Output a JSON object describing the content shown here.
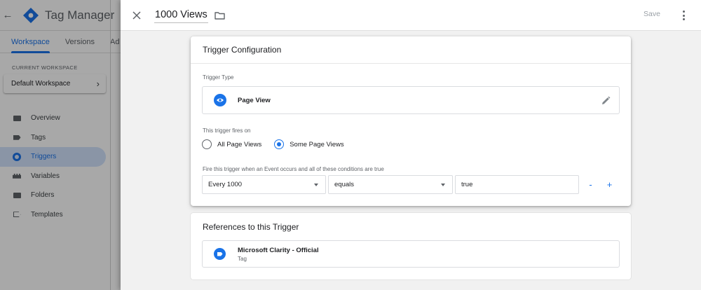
{
  "bg_app": {
    "product_name": "Tag Manager",
    "tabs": [
      {
        "label": "Workspace",
        "active": true
      },
      {
        "label": "Versions",
        "active": false
      },
      {
        "label": "Ad",
        "active": false
      }
    ],
    "current_workspace_label": "CURRENT WORKSPACE",
    "workspace_name": "Default Workspace",
    "nav": [
      {
        "label": "Overview",
        "icon": "folder-icon",
        "active": false
      },
      {
        "label": "Tags",
        "icon": "tag-icon",
        "active": false
      },
      {
        "label": "Triggers",
        "icon": "trigger-icon",
        "active": true
      },
      {
        "label": "Variables",
        "icon": "variables-icon",
        "active": false
      },
      {
        "label": "Folders",
        "icon": "folder-icon",
        "active": false
      },
      {
        "label": "Templates",
        "icon": "template-icon",
        "active": false
      }
    ]
  },
  "panel": {
    "title": "1000 Views",
    "save_label": "Save"
  },
  "trigger_config": {
    "heading": "Trigger Configuration",
    "type_label": "Trigger Type",
    "type_name": "Page View",
    "fires_on_label": "This trigger fires on",
    "fires_on_options": [
      {
        "label": "All Page Views",
        "checked": false
      },
      {
        "label": "Some Page Views",
        "checked": true
      }
    ],
    "condition_label": "Fire this trigger when an Event occurs and all of these conditions are true",
    "condition": {
      "variable": "Every 1000",
      "operator": "equals",
      "value": "true"
    },
    "remove_label": "-",
    "add_label": "+"
  },
  "references": {
    "heading": "References to this Trigger",
    "items": [
      {
        "name": "Microsoft Clarity - Official",
        "kind": "Tag"
      }
    ]
  },
  "colors": {
    "accent": "#1a73e8",
    "active_nav_bg": "#d2e3fc",
    "panel_bg": "#f1f1f1"
  }
}
